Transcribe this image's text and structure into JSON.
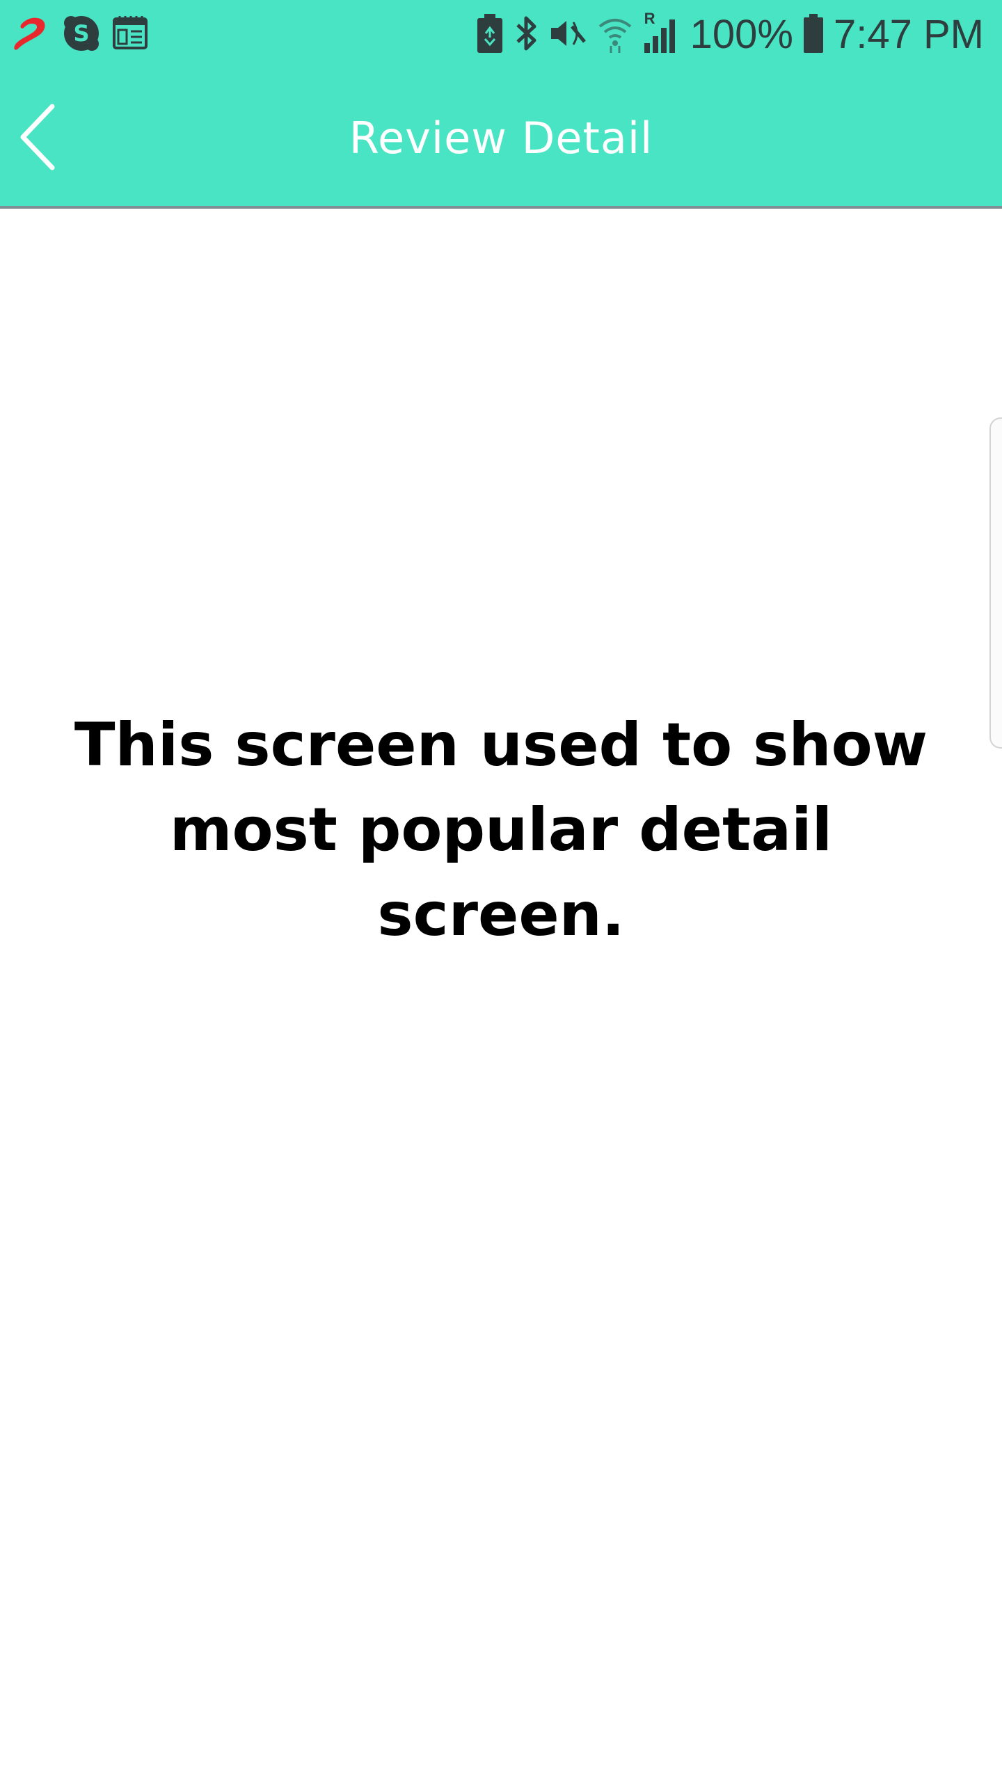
{
  "status_bar": {
    "left_icons": [
      "airtel-icon",
      "skype-icon",
      "calendar-icon"
    ],
    "right_icons": [
      "battery-saver-icon",
      "bluetooth-icon",
      "mute-icon",
      "wifi-icon",
      "signal-icon"
    ],
    "signal_roaming_label": "R",
    "battery_text": "100%",
    "time": "7:47 PM"
  },
  "app_bar": {
    "title": "Review Detail",
    "back_icon": "chevron-left-icon"
  },
  "main": {
    "message_line1": "This screen used to show",
    "message_line2": "most popular detail screen."
  },
  "colors": {
    "accent": "#49e4c3",
    "status_icon": "#2e3e3f",
    "airtel_red": "#e8282d",
    "text": "#000000",
    "title_text": "#ffffff"
  }
}
